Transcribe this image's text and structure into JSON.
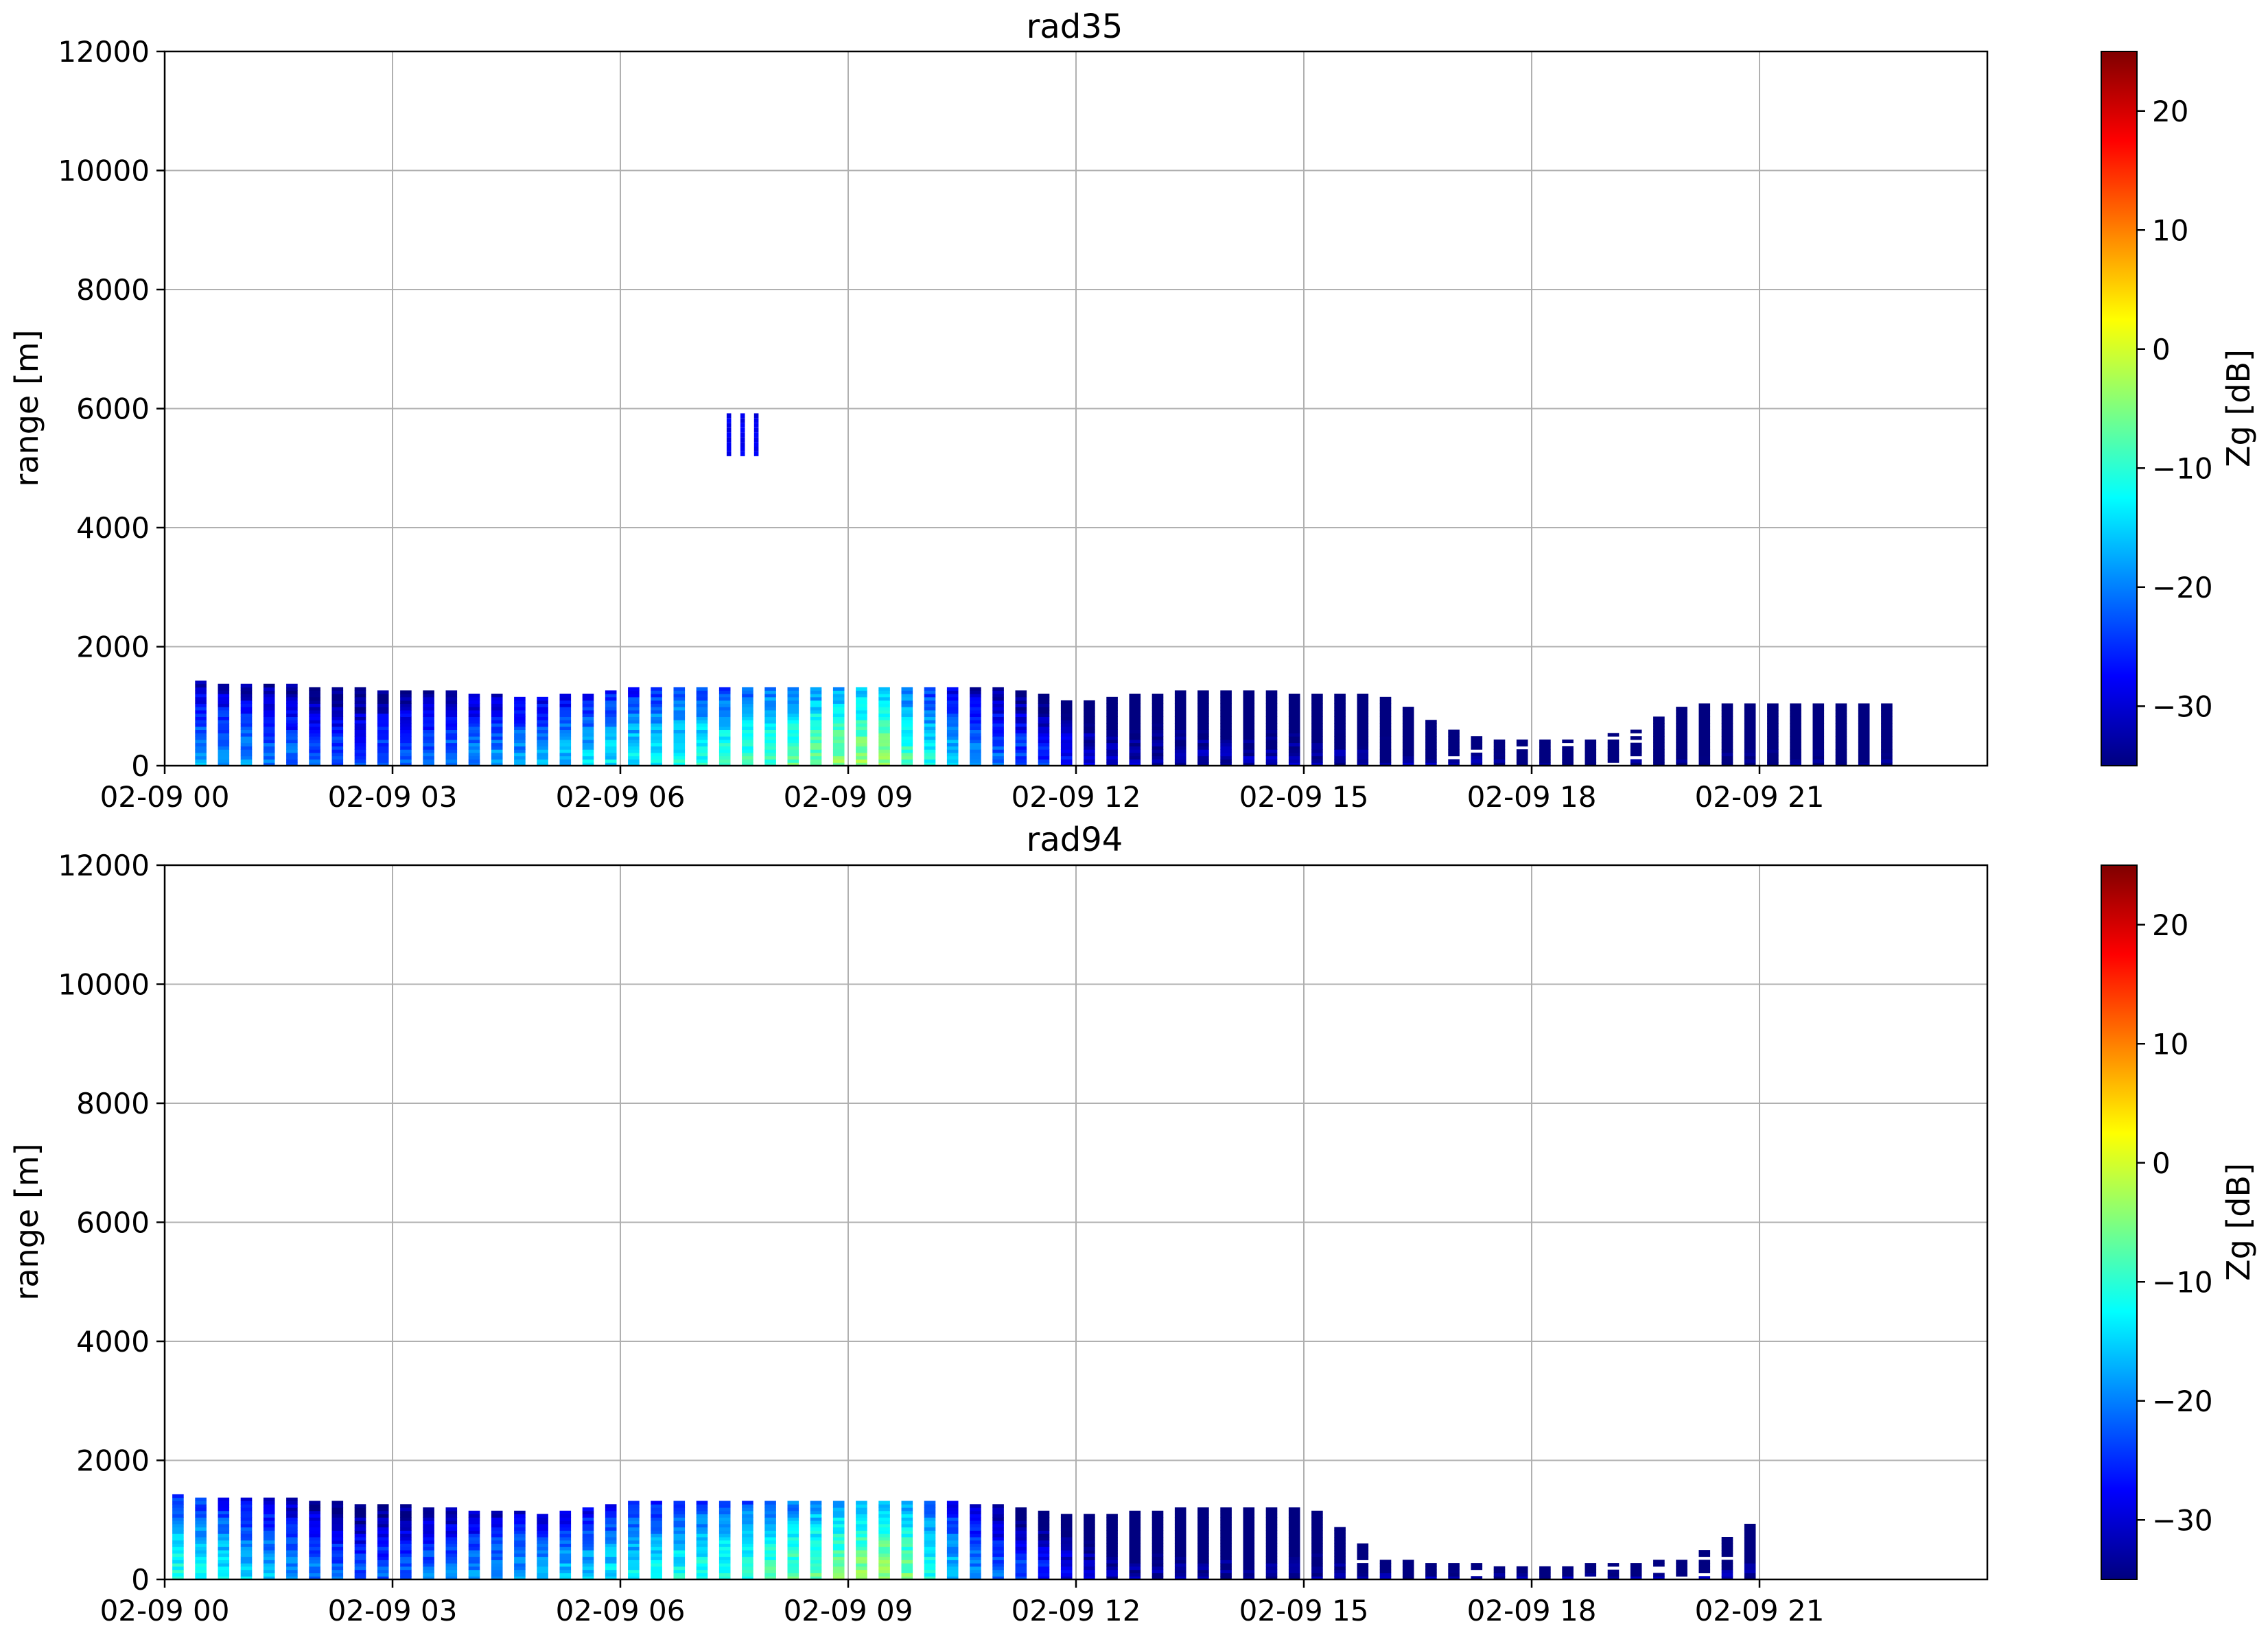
{
  "chart_data": [
    {
      "type": "heatmap",
      "title": "rad35",
      "xlabel": "",
      "ylabel": "range [m]",
      "colorbar_label": "Zg [dB]",
      "colormap": "jet",
      "grid": true,
      "x_ticks": [
        "02-09 00",
        "02-09 03",
        "02-09 06",
        "02-09 09",
        "02-09 12",
        "02-09 15",
        "02-09 18",
        "02-09 21"
      ],
      "x_tick_hours": [
        0,
        3,
        6,
        9,
        12,
        15,
        18,
        21
      ],
      "xlim_hours": [
        0,
        24
      ],
      "y_ticks": [
        0,
        2000,
        4000,
        6000,
        8000,
        10000,
        12000
      ],
      "ylim": [
        0,
        12000
      ],
      "clim": [
        -35,
        25
      ],
      "colorbar_ticks": [
        -30,
        -20,
        -10,
        0,
        10,
        20
      ],
      "cloud_layer": {
        "description_hours_vs_top_m": [
          [
            0.4,
            1380
          ],
          [
            1.5,
            1330
          ],
          [
            3.0,
            1250
          ],
          [
            4.0,
            1200
          ],
          [
            5.0,
            1120
          ],
          [
            6.0,
            1300
          ],
          [
            7.0,
            1320
          ],
          [
            8.0,
            1320
          ],
          [
            9.0,
            1320
          ],
          [
            10.0,
            1320
          ],
          [
            11.0,
            1300
          ],
          [
            12.0,
            1050
          ],
          [
            13.0,
            1200
          ],
          [
            14.0,
            1250
          ],
          [
            15.0,
            1200
          ],
          [
            16.0,
            1150
          ],
          [
            17.0,
            500
          ],
          [
            18.0,
            400
          ],
          [
            19.0,
            500
          ],
          [
            20.0,
            1000
          ],
          [
            21.0,
            1050
          ],
          [
            22.0,
            1000
          ],
          [
            22.8,
            1000
          ]
        ],
        "peak_zg_dB_hours": [
          [
            0.5,
            -15
          ],
          [
            2.5,
            -20
          ],
          [
            8.0,
            -5
          ],
          [
            9.3,
            0
          ],
          [
            10.5,
            -15
          ],
          [
            12.5,
            -28
          ],
          [
            16,
            -30
          ],
          [
            20,
            -32
          ]
        ]
      },
      "elevated_layer": {
        "hours": [
          7.4,
          7.9
        ],
        "range_m": [
          5200,
          5900
        ],
        "zg_dB": -30
      }
    },
    {
      "type": "heatmap",
      "title": "rad94",
      "xlabel": "",
      "ylabel": "range [m]",
      "colorbar_label": "Zg [dB]",
      "colormap": "jet",
      "grid": true,
      "x_ticks": [
        "02-09 00",
        "02-09 03",
        "02-09 06",
        "02-09 09",
        "02-09 12",
        "02-09 15",
        "02-09 18",
        "02-09 21"
      ],
      "x_tick_hours": [
        0,
        3,
        6,
        9,
        12,
        15,
        18,
        21
      ],
      "xlim_hours": [
        0,
        24
      ],
      "y_ticks": [
        0,
        2000,
        4000,
        6000,
        8000,
        10000,
        12000
      ],
      "ylim": [
        0,
        12000
      ],
      "clim": [
        -35,
        25
      ],
      "colorbar_ticks": [
        -30,
        -20,
        -10,
        0,
        10,
        20
      ],
      "cloud_layer": {
        "description_hours_vs_top_m": [
          [
            0.1,
            1380
          ],
          [
            1.5,
            1330
          ],
          [
            3.0,
            1230
          ],
          [
            4.0,
            1150
          ],
          [
            5.0,
            1080
          ],
          [
            6.0,
            1280
          ],
          [
            7.0,
            1300
          ],
          [
            8.0,
            1300
          ],
          [
            9.0,
            1320
          ],
          [
            10.0,
            1320
          ],
          [
            11.0,
            1200
          ],
          [
            12.0,
            1050
          ],
          [
            13.0,
            1150
          ],
          [
            14.0,
            1200
          ],
          [
            15.0,
            1200
          ],
          [
            16.0,
            300
          ],
          [
            18.0,
            200
          ],
          [
            20.0,
            300
          ],
          [
            21.0,
            1050
          ]
        ],
        "peak_zg_dB_hours": [
          [
            0.2,
            -8
          ],
          [
            2.5,
            -20
          ],
          [
            8.0,
            -5
          ],
          [
            9.5,
            0
          ],
          [
            10.5,
            -15
          ],
          [
            12.5,
            -30
          ]
        ]
      },
      "elevated_layer": null
    }
  ]
}
